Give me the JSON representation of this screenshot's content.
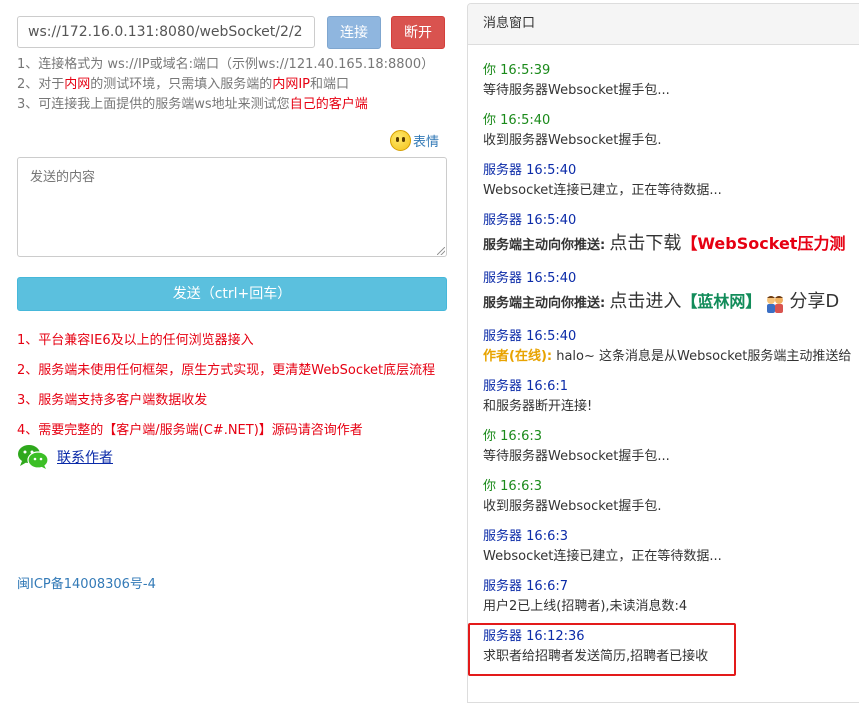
{
  "connect": {
    "url_value": "ws://172.16.0.131:8080/webSocket/2/2",
    "connect_label": "连接",
    "disconnect_label": "断开"
  },
  "tips": {
    "line1": "1、连接格式为 ws://IP或域名:端口（示例ws://121.40.165.18:8800）",
    "line2_a": "2、对于",
    "line2_b": "内网",
    "line2_c": "的测试环境，只需填入服务端的",
    "line2_d": "内网IP",
    "line2_e": "和端口",
    "line3_a": "3、可连接我上面提供的服务端ws地址来测试您",
    "line3_b": "自己的客户端"
  },
  "emoji_label": "表情",
  "send": {
    "placeholder": "发送的内容",
    "button_label": "发送（ctrl+回车）"
  },
  "notes": [
    "1、平台兼容IE6及以上的任何浏览器接入",
    "2、服务端未使用任何框架，原生方式实现，更清楚WebSocket底层流程",
    "3、服务端支持多客户端数据收发",
    "4、需要完整的【客户端/服务端(C#.NET)】源码请咨询作者"
  ],
  "contact_label": "联系作者",
  "icp": "闽ICP备14008306号-4",
  "panel": {
    "title": "消息窗口",
    "messages": [
      {
        "who": "你",
        "time": "16:5:39",
        "text": "等待服务器Websocket握手包..."
      },
      {
        "who": "你",
        "time": "16:5:40",
        "text": "收到服务器Websocket握手包."
      },
      {
        "who": "服务器",
        "time": "16:5:40",
        "text": "Websocket连接已建立，正在等待数据..."
      },
      {
        "who": "服务器",
        "time": "16:5:40",
        "label": "服务端主动向你推送:",
        "text_a": "点击下载",
        "text_b": "【WebSocket压力测"
      },
      {
        "who": "服务器",
        "time": "16:5:40",
        "label": "服务端主动向你推送:",
        "text_a": "点击进入",
        "text_b": "【蓝林网】",
        "text_c": "分享D"
      },
      {
        "who": "服务器",
        "time": "16:5:40",
        "author": "作者(在线):",
        "text": " halo~ 这条消息是从Websocket服务端主动推送给"
      },
      {
        "who": "服务器",
        "time": "16:6:1",
        "text": "和服务器断开连接!"
      },
      {
        "who": "你",
        "time": "16:6:3",
        "text": "等待服务器Websocket握手包..."
      },
      {
        "who": "你",
        "time": "16:6:3",
        "text": "收到服务器Websocket握手包."
      },
      {
        "who": "服务器",
        "time": "16:6:3",
        "text": "Websocket连接已建立，正在等待数据..."
      },
      {
        "who": "服务器",
        "time": "16:6:7",
        "text": "用户2已上线(招聘者),未读消息数:4"
      },
      {
        "who": "服务器",
        "time": "16:12:36",
        "text": "求职者给招聘者发送简历,招聘者已接收"
      }
    ]
  },
  "colors": {
    "connect_btn": "#8fb6df",
    "disconnect_btn": "#d9534f",
    "send_btn": "#5bc0de",
    "you_color": "#1a8a1a",
    "server_color": "#0a2aa8",
    "highlight": "#e31a1a"
  }
}
